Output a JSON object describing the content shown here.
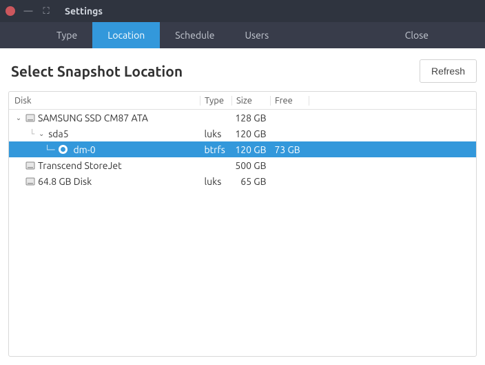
{
  "window": {
    "title": "Settings"
  },
  "tabs": {
    "type": "Type",
    "location": "Location",
    "schedule": "Schedule",
    "users": "Users",
    "close": "Close"
  },
  "page": {
    "title": "Select Snapshot Location",
    "refresh": "Refresh"
  },
  "columns": {
    "disk": "Disk",
    "type": "Type",
    "size": "Size",
    "free": "Free"
  },
  "rows": [
    {
      "name": "SAMSUNG SSD CM87 ATA",
      "type": "",
      "size": "128 GB",
      "free": ""
    },
    {
      "name": "sda5",
      "type": "luks",
      "size": "120 GB",
      "free": ""
    },
    {
      "name": "dm-0",
      "type": "btrfs",
      "size": "120 GB",
      "free": "73 GB"
    },
    {
      "name": "Transcend StoreJet",
      "type": "",
      "size": "500 GB",
      "free": ""
    },
    {
      "name": "64.8 GB Disk",
      "type": "luks",
      "size": "65 GB",
      "free": ""
    }
  ]
}
